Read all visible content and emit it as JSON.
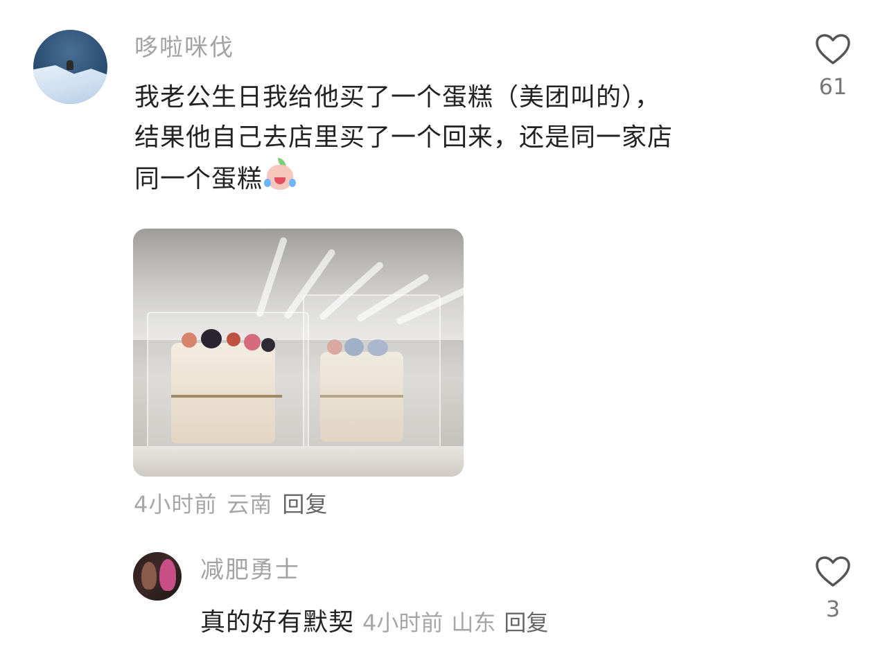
{
  "main_comment": {
    "username": "哆啦咪伐",
    "text_line1": "我老公生日我给他买了一个蛋糕（美团叫的），",
    "text_line2": "结果他自己去店里买了一个回来，还是同一家店",
    "text_line3": "同一个蛋糕",
    "emoji": "crying-laughing-peach-emoji",
    "time": "4小时前",
    "location": "云南",
    "reply_label": "回复",
    "likes": "61"
  },
  "reply_comment": {
    "username": "减肥勇士",
    "text": "真的好有默契",
    "time": "4小时前",
    "location": "山东",
    "reply_label": "回复",
    "likes": "3"
  },
  "icons": {
    "like": "heart-outline-icon"
  },
  "colors": {
    "username": "#a3a3a3",
    "text": "#222222",
    "meta": "#a6a6a6",
    "reply": "#666666"
  }
}
